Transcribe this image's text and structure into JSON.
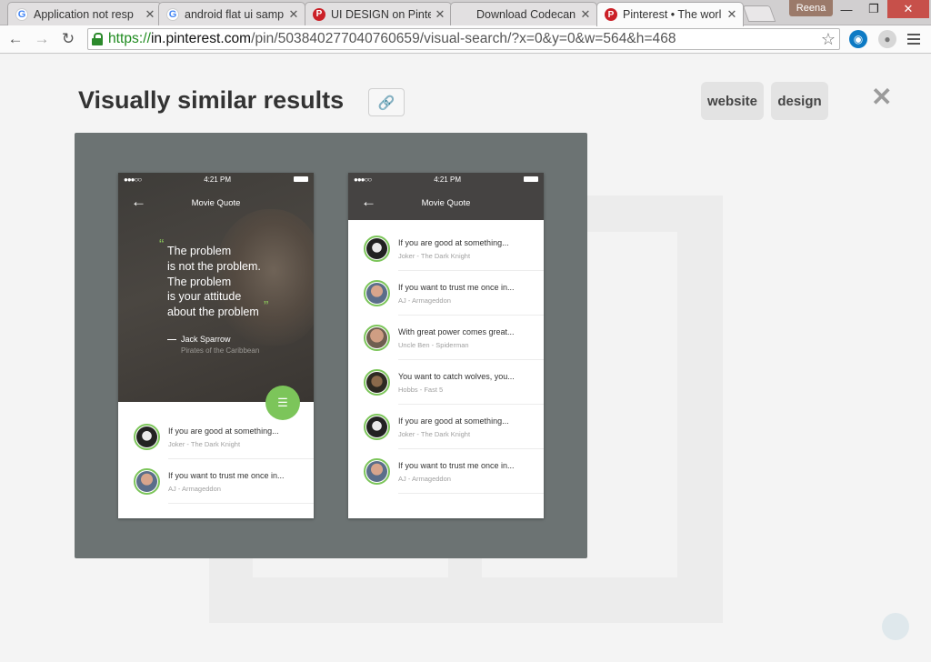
{
  "browser": {
    "tabs": [
      {
        "favicon": "G",
        "favicon_type": "g",
        "title": "Application not resp",
        "active": false
      },
      {
        "favicon": "G",
        "favicon_type": "g",
        "title": "android flat ui samp",
        "active": false
      },
      {
        "favicon": "P",
        "favicon_type": "p",
        "title": "UI DESIGN on Pinte",
        "active": false
      },
      {
        "favicon": "",
        "favicon_type": "none",
        "title": "Download Codecan",
        "active": false
      },
      {
        "favicon": "P",
        "favicon_type": "p",
        "title": "Pinterest • The worl",
        "active": true
      }
    ],
    "profile_name": "Reena",
    "window_controls": {
      "minimize": "—",
      "restore": "❐",
      "close": "✕"
    },
    "url": {
      "scheme": "https://",
      "host": "in.pinterest.com",
      "path": "/pin/503840277040760659/visual-search/?x=0&y=0&w=564&h=468"
    },
    "icons": {
      "back": "back-arrow-icon",
      "forward": "forward-arrow-icon",
      "reload": "reload-icon",
      "lock": "lock-icon",
      "star": "star-icon",
      "menu": "hamburger-menu-icon"
    }
  },
  "page": {
    "title": "Visually similar results",
    "tags": [
      "website",
      "design"
    ],
    "close_glyph": "✕",
    "link_glyph": "🔗"
  },
  "preview": {
    "left_phone": {
      "status_time": "4:21 PM",
      "app_title": "Movie Quote",
      "quote_lines": [
        "The problem",
        "is not the problem.",
        "The problem",
        "is your attitude",
        "about the problem"
      ],
      "author": "Jack Sparrow",
      "source": "Pirates of the Caribbean",
      "fab_glyph": "☰",
      "items": [
        {
          "avatar": "joker",
          "quote": "If you are good at something...",
          "source": "Joker - The Dark Knight"
        },
        {
          "avatar": "aj",
          "quote": "If you want to trust me once in...",
          "source": "AJ - Armageddon"
        }
      ]
    },
    "right_phone": {
      "status_time": "4:21 PM",
      "app_title": "Movie Quote",
      "items": [
        {
          "avatar": "joker",
          "quote": "If you are good at something...",
          "source": "Joker - The Dark Knight"
        },
        {
          "avatar": "aj",
          "quote": "If you want to trust me once in...",
          "source": "AJ - Armageddon"
        },
        {
          "avatar": "ben",
          "quote": "With great power comes great...",
          "source": "Uncle Ben - Spiderman"
        },
        {
          "avatar": "hobbs",
          "quote": "You want to catch wolves, you...",
          "source": "Hobbs - Fast 5"
        },
        {
          "avatar": "joker",
          "quote": "If you are good at something...",
          "source": "Joker - The Dark Knight"
        },
        {
          "avatar": "aj",
          "quote": "If you want to trust me once in...",
          "source": "AJ - Armageddon"
        }
      ]
    }
  },
  "colors": {
    "accent_green": "#7cc55a",
    "preview_bg": "#6c7373",
    "pinterest_red": "#cb2027"
  }
}
